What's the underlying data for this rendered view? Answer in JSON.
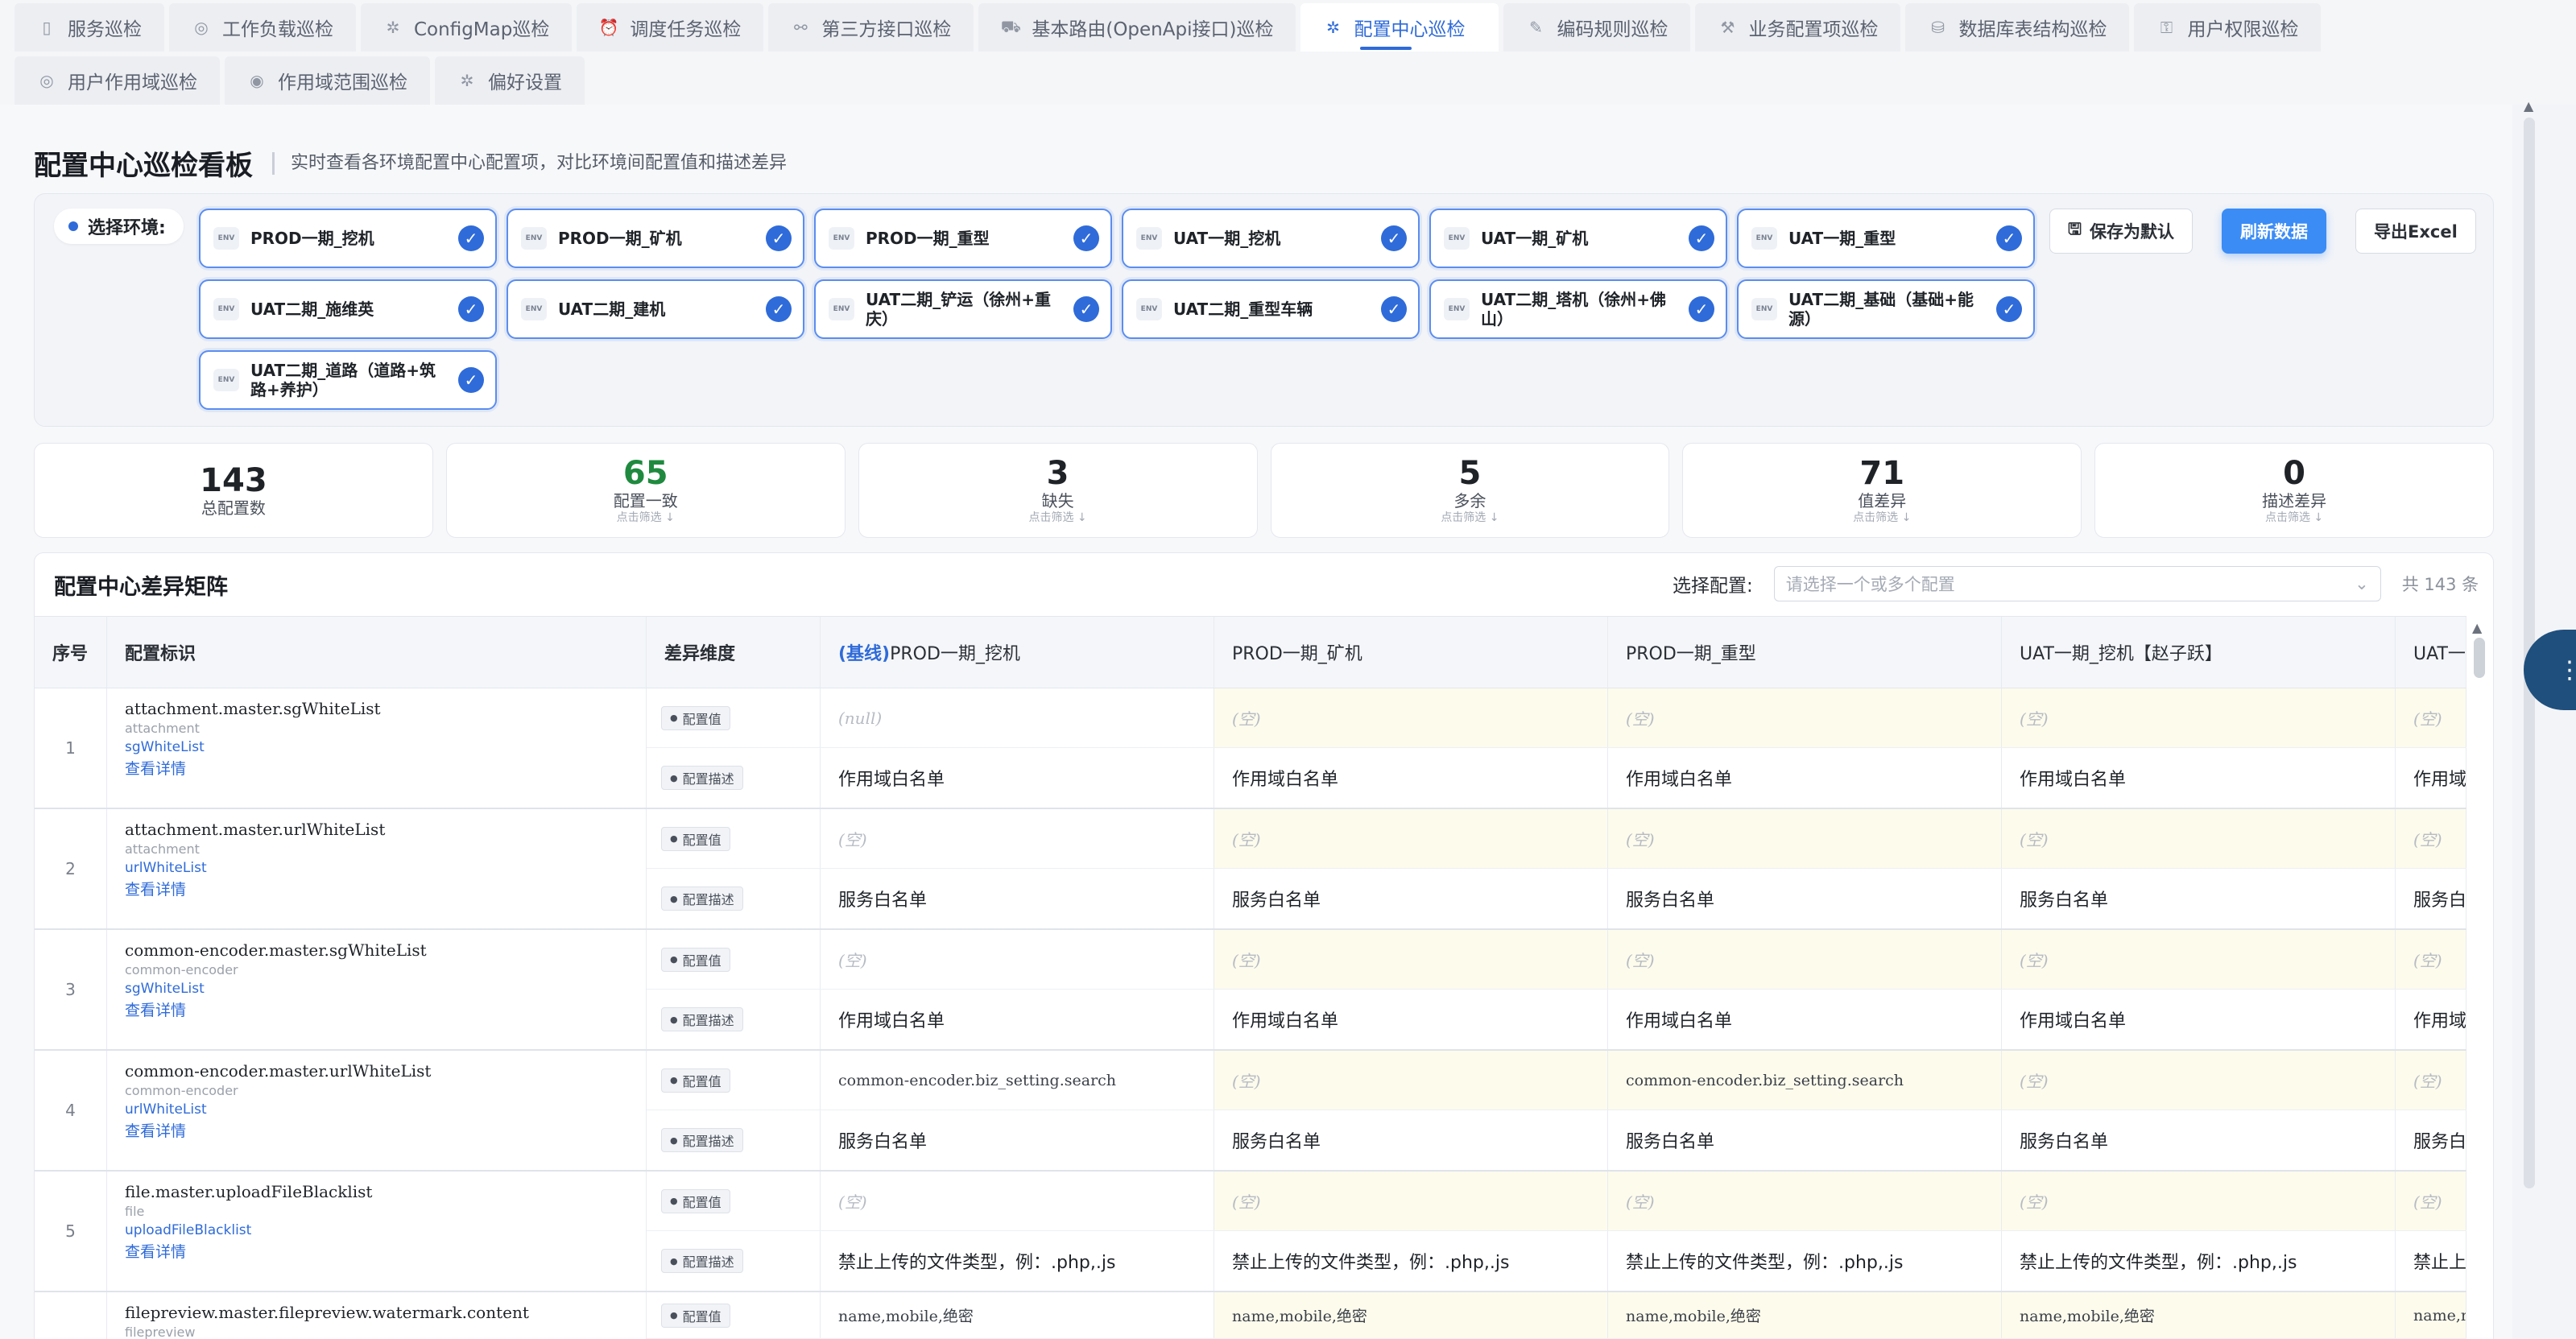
{
  "tabs_row1": [
    {
      "label": "服务巡检",
      "icon": "document-icon",
      "glyph": "▯"
    },
    {
      "label": "工作负载巡检",
      "icon": "target-icon",
      "glyph": "◎"
    },
    {
      "label": "ConfigMap巡检",
      "icon": "gear-icon",
      "glyph": "✲"
    },
    {
      "label": "调度任务巡检",
      "icon": "alarm-clock-icon",
      "glyph": "⏰"
    },
    {
      "label": "第三方接口巡检",
      "icon": "link-icon",
      "glyph": "⚯"
    },
    {
      "label": "基本路由(OpenApi接口)巡检",
      "icon": "route-icon",
      "glyph": "⛟"
    },
    {
      "label": "配置中心巡检",
      "icon": "settings-icon",
      "glyph": "✲"
    },
    {
      "label": "编码规则巡检",
      "icon": "edit-icon",
      "glyph": "✎"
    },
    {
      "label": "业务配置项巡检",
      "icon": "wrench-icon",
      "glyph": "⚒"
    },
    {
      "label": "数据库表结构巡检",
      "icon": "database-icon",
      "glyph": "⛁"
    },
    {
      "label": "用户权限巡检",
      "icon": "lock-icon",
      "glyph": "⚿"
    }
  ],
  "tabs_row2": [
    {
      "label": "用户作用域巡检",
      "icon": "target-icon",
      "glyph": "◎"
    },
    {
      "label": "作用域范围巡检",
      "icon": "scope-icon",
      "glyph": "◉"
    },
    {
      "label": "偏好设置",
      "icon": "gear-icon",
      "glyph": "✲"
    }
  ],
  "active_tab": "配置中心巡检",
  "header": {
    "title": "配置中心巡检看板",
    "subtitle": "实时查看各环境配置中心配置项，对比环境间配置值和描述差异"
  },
  "env": {
    "label": "选择环境:",
    "icon_text": "ENV",
    "chips": [
      "PROD一期_挖机",
      "PROD一期_矿机",
      "PROD一期_重型",
      "UAT一期_挖机",
      "UAT一期_矿机",
      "UAT一期_重型",
      "UAT二期_施维英",
      "UAT二期_建机",
      "UAT二期_铲运（徐州+重庆）",
      "UAT二期_重型车辆",
      "UAT二期_塔机（徐州+佛山）",
      "UAT二期_基础（基础+能源）",
      "UAT二期_道路（道路+筑路+养护）"
    ],
    "actions": {
      "save_default": "保存为默认",
      "refresh": "刷新数据",
      "export": "导出Excel"
    }
  },
  "stats": [
    {
      "num": "143",
      "label": "总配置数",
      "hint": ""
    },
    {
      "num": "65",
      "label": "配置一致",
      "hint": "点击筛选 ↓",
      "color": "#1f8a3f"
    },
    {
      "num": "3",
      "label": "缺失",
      "hint": "点击筛选 ↓"
    },
    {
      "num": "5",
      "label": "多余",
      "hint": "点击筛选 ↓"
    },
    {
      "num": "71",
      "label": "值差异",
      "hint": "点击筛选 ↓"
    },
    {
      "num": "0",
      "label": "描述差异",
      "hint": "点击筛选 ↓"
    }
  ],
  "matrix": {
    "title": "配置中心差异矩阵",
    "filter_label": "选择配置:",
    "filter_placeholder": "请选择一个或多个配置",
    "total": "共 143 条",
    "columns": {
      "index": "序号",
      "key": "配置标识",
      "dim": "差异维度",
      "base_tag": "(基线)",
      "base_env": "PROD一期_挖机",
      "envs": [
        "PROD一期_矿机",
        "PROD一期_重型",
        "UAT一期_挖机【赵子跃】",
        "UAT一期"
      ]
    },
    "dim_value": "配置值",
    "dim_desc": "配置描述",
    "detail_link": "查看详情",
    "rows": [
      {
        "idx": "1",
        "key": "attachment.master.sgWhiteList",
        "group": "attachment",
        "short": "sgWhiteList",
        "values": [
          "(null)",
          "(空)",
          "(空)",
          "(空)",
          "(空)"
        ],
        "descs": [
          "作用域白名单",
          "作用域白名单",
          "作用域白名单",
          "作用域白名单",
          "作用域"
        ]
      },
      {
        "idx": "2",
        "key": "attachment.master.urlWhiteList",
        "group": "attachment",
        "short": "urlWhiteList",
        "values": [
          "(空)",
          "(空)",
          "(空)",
          "(空)",
          "(空)"
        ],
        "descs": [
          "服务白名单",
          "服务白名单",
          "服务白名单",
          "服务白名单",
          "服务白"
        ]
      },
      {
        "idx": "3",
        "key": "common-encoder.master.sgWhiteList",
        "group": "common-encoder",
        "short": "sgWhiteList",
        "values": [
          "(空)",
          "(空)",
          "(空)",
          "(空)",
          "(空)"
        ],
        "descs": [
          "作用域白名单",
          "作用域白名单",
          "作用域白名单",
          "作用域白名单",
          "作用域"
        ]
      },
      {
        "idx": "4",
        "key": "common-encoder.master.urlWhiteList",
        "group": "common-encoder",
        "short": "urlWhiteList",
        "values": [
          "common-encoder.biz_setting.search",
          "(空)",
          "common-encoder.biz_setting.search",
          "(空)",
          "(空)"
        ],
        "descs": [
          "服务白名单",
          "服务白名单",
          "服务白名单",
          "服务白名单",
          "服务白"
        ]
      },
      {
        "idx": "5",
        "key": "file.master.uploadFileBlacklist",
        "group": "file",
        "short": "uploadFileBlacklist",
        "values": [
          "(空)",
          "(空)",
          "(空)",
          "(空)",
          "(空)"
        ],
        "descs": [
          "禁止上传的文件类型，例：.php,.js",
          "禁止上传的文件类型，例：.php,.js",
          "禁止上传的文件类型，例：.php,.js",
          "禁止上传的文件类型，例：.php,.js",
          "禁止上"
        ]
      },
      {
        "idx": "",
        "key": "filepreview.master.filepreview.watermark.content",
        "group": "filepreview",
        "short": "",
        "values": [
          "name,mobile,绝密",
          "name,mobile,绝密",
          "name,mobile,绝密",
          "name,mobile,绝密",
          "name,m"
        ],
        "descs": []
      }
    ]
  },
  "side_button_glyph": "⋮"
}
